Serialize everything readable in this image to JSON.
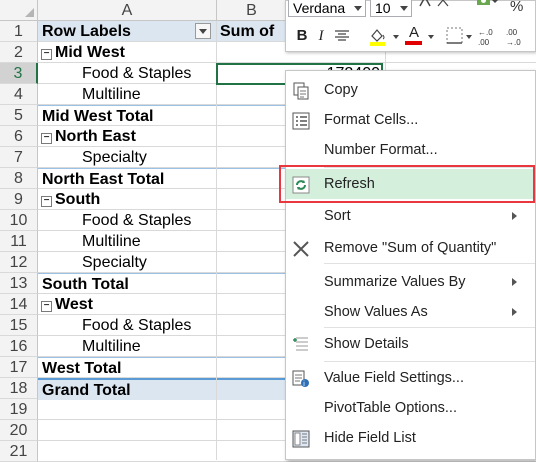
{
  "columns": [
    "A",
    "B"
  ],
  "rows": [
    {
      "num": "1",
      "a": "Row Labels",
      "b": "Sum of",
      "style": "header"
    },
    {
      "num": "2",
      "a": "Mid West",
      "style": "group"
    },
    {
      "num": "3",
      "a": "Food & Staples",
      "b": "172400",
      "style": "item"
    },
    {
      "num": "4",
      "a": "Multiline",
      "style": "item"
    },
    {
      "num": "5",
      "a": "Mid West Total",
      "style": "total"
    },
    {
      "num": "6",
      "a": "North East",
      "style": "group"
    },
    {
      "num": "7",
      "a": "Specialty",
      "style": "item"
    },
    {
      "num": "8",
      "a": "North East Total",
      "style": "total"
    },
    {
      "num": "9",
      "a": "South",
      "style": "group"
    },
    {
      "num": "10",
      "a": "Food & Staples",
      "style": "item"
    },
    {
      "num": "11",
      "a": "Multiline",
      "style": "item"
    },
    {
      "num": "12",
      "a": "Specialty",
      "style": "item"
    },
    {
      "num": "13",
      "a": "South Total",
      "style": "total"
    },
    {
      "num": "14",
      "a": "West",
      "style": "group"
    },
    {
      "num": "15",
      "a": "Food & Staples",
      "style": "item"
    },
    {
      "num": "16",
      "a": "Multiline",
      "style": "item"
    },
    {
      "num": "17",
      "a": "West Total",
      "style": "total"
    },
    {
      "num": "18",
      "a": "Grand Total",
      "style": "grand"
    },
    {
      "num": "19"
    },
    {
      "num": "20"
    },
    {
      "num": "21"
    }
  ],
  "collapse_glyph": "⊟",
  "mini_toolbar": {
    "font": "Verdana",
    "size": "10",
    "percent": "%",
    "bold": "B",
    "italic": "I",
    "font_color_letter": "A",
    "decimals": [
      ".00\n→.0",
      ".00\n←.0"
    ],
    "highlight_color": "#ffff00",
    "font_color": "#e00000"
  },
  "menu": {
    "items": [
      {
        "label": "Copy",
        "icon": "copy-icon"
      },
      {
        "label": "Format Cells...",
        "icon": "format-cells-icon"
      },
      {
        "label": "Number Format..."
      },
      {
        "label": "Refresh",
        "icon": "refresh-icon",
        "highlight": true
      },
      {
        "label": "Sort",
        "submenu": true
      },
      {
        "label": "Remove \"Sum of Quantity\"",
        "icon": "remove-x-icon"
      },
      {
        "label": "Summarize Values By",
        "submenu": true
      },
      {
        "label": "Show Values As",
        "submenu": true
      },
      {
        "label": "Show Details",
        "icon": "show-details-icon"
      },
      {
        "label": "Value Field Settings...",
        "icon": "field-settings-icon"
      },
      {
        "label": "PivotTable Options..."
      },
      {
        "label": "Hide Field List",
        "icon": "field-list-icon"
      }
    ]
  },
  "colors": {
    "header_fill": "#dce6f1",
    "highlight": "#d4f0dd",
    "callout": "#e8373e",
    "accent": "#217346"
  }
}
